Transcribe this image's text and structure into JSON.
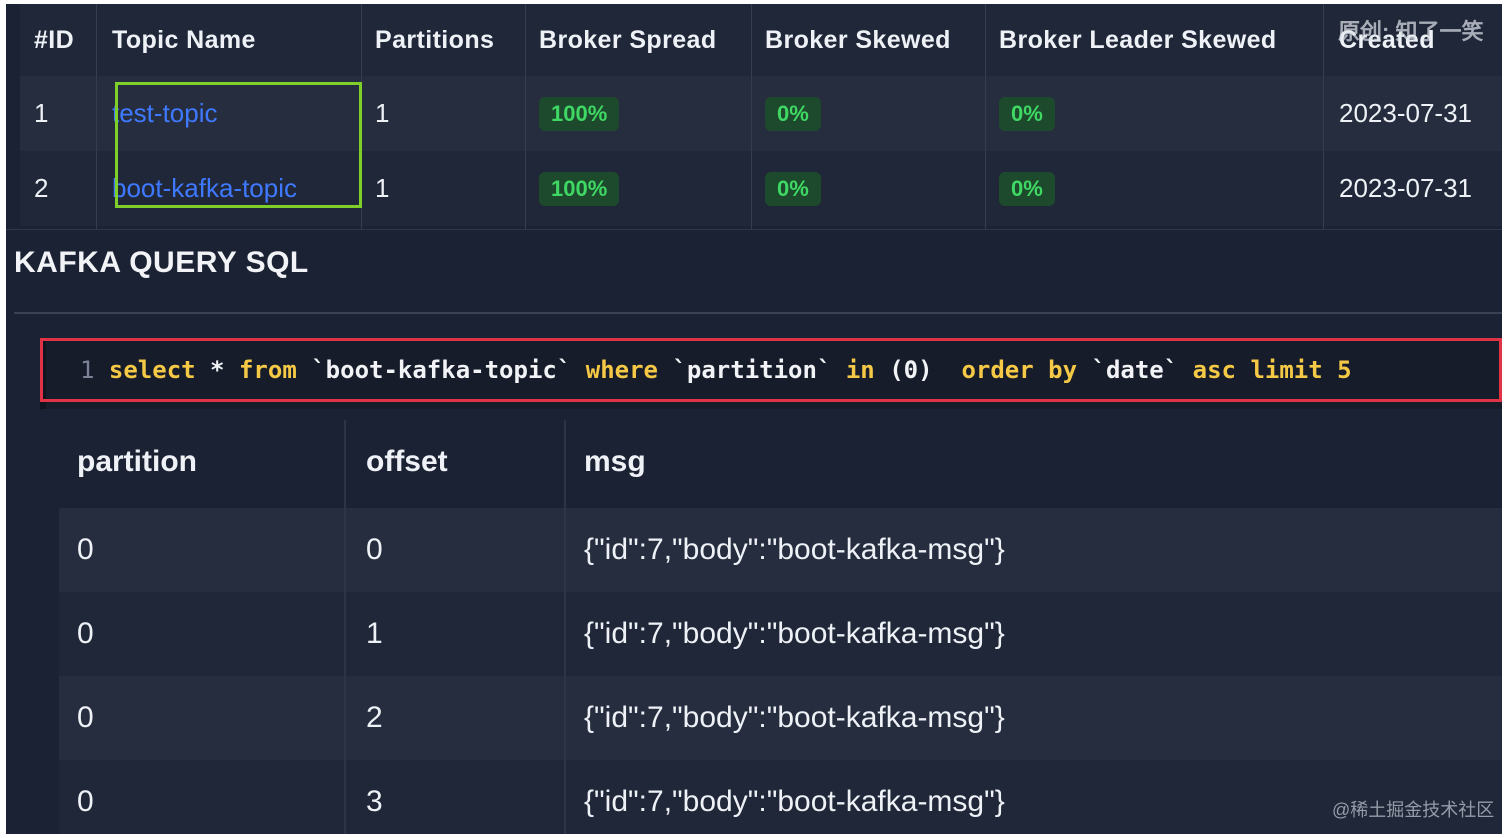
{
  "topics": {
    "columns": [
      "#ID",
      "Topic Name",
      "Partitions",
      "Broker Spread",
      "Broker Skewed",
      "Broker Leader Skewed",
      "Created"
    ],
    "rows": [
      {
        "id": "1",
        "name": "test-topic",
        "partitions": "1",
        "spread": "100%",
        "skewed": "0%",
        "leader_skewed": "0%",
        "created": "2023-07-31"
      },
      {
        "id": "2",
        "name": "boot-kafka-topic",
        "partitions": "1",
        "spread": "100%",
        "skewed": "0%",
        "leader_skewed": "0%",
        "created": "2023-07-31"
      }
    ],
    "highlight_color": "#7fcf2b"
  },
  "watermark_top": "原创: 知了一笑",
  "query": {
    "title": "KAFKA QUERY SQL",
    "line_number": "1",
    "tokens": {
      "select": "select",
      "star": " * ",
      "from": "from",
      "table": " `boot-kafka-topic` ",
      "where": "where",
      "column": " `partition` ",
      "in": "in",
      "value": " (0)  ",
      "order_by": "order by",
      "date_col": " `date` ",
      "asc": "asc",
      "limit": " limit",
      "limit_value": " 5"
    },
    "highlight_color": "#e03345",
    "keyword_color": "#f5c945"
  },
  "results": {
    "columns": [
      "partition",
      "offset",
      "msg"
    ],
    "rows": [
      {
        "partition": "0",
        "offset": "0",
        "msg": "{\"id\":7,\"body\":\"boot-kafka-msg\"}"
      },
      {
        "partition": "0",
        "offset": "1",
        "msg": "{\"id\":7,\"body\":\"boot-kafka-msg\"}"
      },
      {
        "partition": "0",
        "offset": "2",
        "msg": "{\"id\":7,\"body\":\"boot-kafka-msg\"}"
      },
      {
        "partition": "0",
        "offset": "3",
        "msg": "{\"id\":7,\"body\":\"boot-kafka-msg\"}"
      }
    ]
  },
  "watermark_bottom": "@稀土掘金技术社区"
}
